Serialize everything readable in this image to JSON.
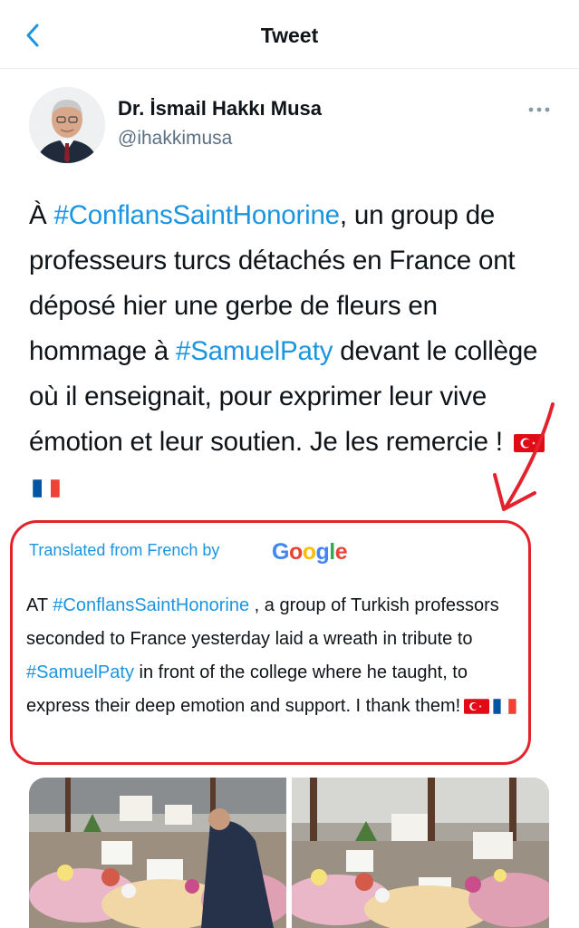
{
  "header": {
    "title": "Tweet"
  },
  "author": {
    "display_name": "Dr. İsmail Hakkı Musa",
    "handle": "@ihakkimusa"
  },
  "tweet": {
    "p1": "À ",
    "hashtag1": "#ConflansSaintHonorine",
    "p2": ", un group de professeurs turcs détachés en France ont déposé hier une gerbe de fleurs en hommage à ",
    "hashtag2": "#SamuelPaty",
    "p3": " devant le collège où il enseignait, pour exprimer leur vive émotion et leur soutien. Je les remercie ! "
  },
  "translation": {
    "label": "Translated from French by",
    "provider": "Google",
    "p1": "AT ",
    "hashtag1": "#ConflansSaintHonorine",
    "p2": " , a group of Turkish professors seconded to France yesterday laid a wreath in tribute to ",
    "hashtag2": "#SamuelPaty",
    "p3": " in front of the college where he taught, to express their deep emotion and support. I thank them!"
  },
  "colors": {
    "link": "#1b95e0",
    "annotation": "#e2222c",
    "secondary_text": "#5b7083"
  },
  "icons": [
    "back-arrow-icon",
    "more-options-icon",
    "turkish-flag-icon",
    "french-flag-icon",
    "google-logo"
  ]
}
